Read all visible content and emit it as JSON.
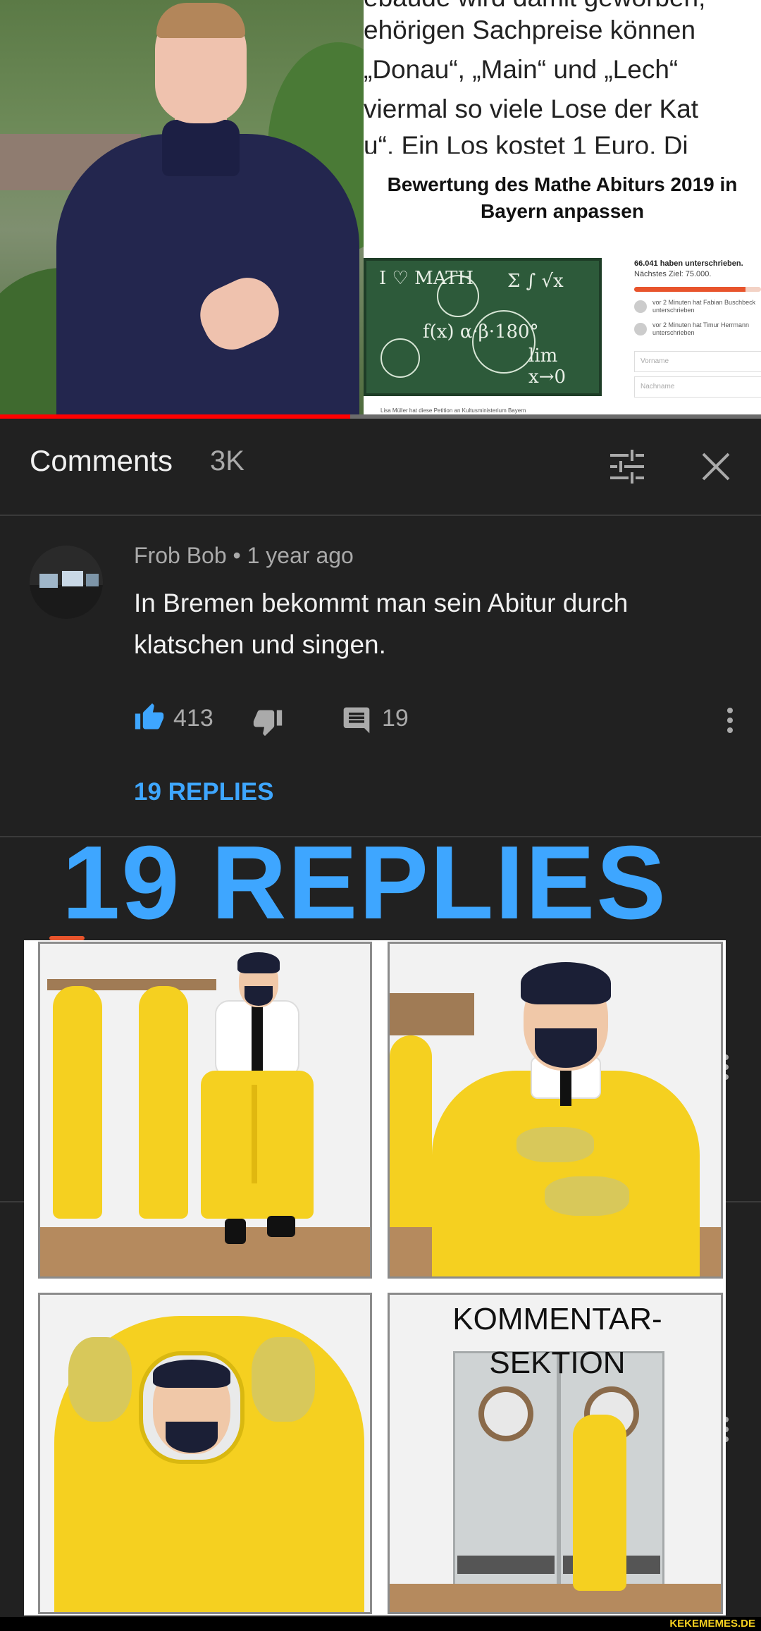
{
  "video": {
    "petition_text_lines": [
      "ebaude wird damit geworben,",
      "ehörigen Sachpreise können",
      "„Donau“, „Main“ und „Lech“",
      "viermal so viele Lose der Kat",
      "u“. Ein Los kostet 1 Euro. Di"
    ],
    "petition_title_line1": "Bewertung des Mathe Abiturs 2019 in",
    "petition_title_line2": "Bayern anpassen",
    "chalk": {
      "c1": "I ♡ MATH",
      "c2": "Σ ∫ √x",
      "c3": "f(x) α·β·180°",
      "c4": "lim x→0"
    },
    "signed": "66.041 haben unterschrieben.",
    "goal": "Nächstes Ziel: 75.000.",
    "signer1": "vor 2 Minuten hat Fabian Buschbeck unterschrieben",
    "signer2": "vor 2 Minuten hat Timur Herrmann unterschrieben",
    "field_first": "Vorname",
    "field_last": "Nachname",
    "footer": "Lisa Müller hat diese Petition an Kultusministerium Bayern",
    "progress": 0.46
  },
  "comments": {
    "title": "Comments",
    "count": "3K"
  },
  "comment": {
    "author": "Frob Bob",
    "time": "1 year ago",
    "text": "In Bremen bekommt man sein Abitur durch klatschen und singen.",
    "likes": "413",
    "replies_count": "19",
    "replies_link": "19 REPLIES"
  },
  "meme": {
    "caption": "19 REPLIES",
    "sign": "KOMMENTAR-\nSEKTION"
  },
  "watermark": "KEKEMEMES.DE",
  "colors": {
    "accent": "#3ea6ff",
    "like": "#3ea6ff",
    "panel": "#212121",
    "suit": "#f5d020"
  },
  "icons": {
    "sort": "sliders-icon",
    "close": "close-icon",
    "like": "thumbs-up-icon",
    "dislike": "thumbs-down-icon",
    "reply": "comment-icon",
    "more": "more-vertical-icon"
  }
}
